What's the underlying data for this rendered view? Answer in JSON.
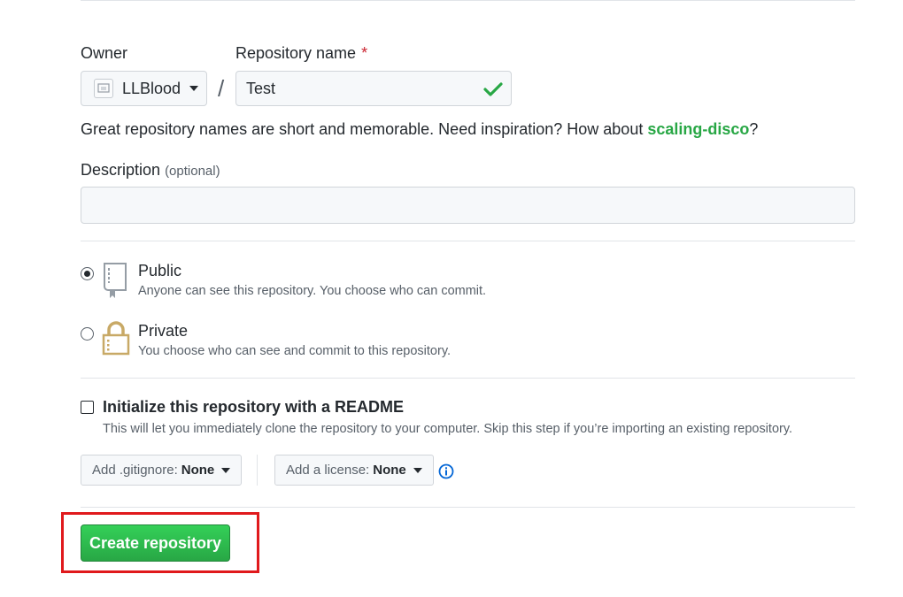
{
  "owner": {
    "label": "Owner",
    "value": "LLBlood"
  },
  "repo_name": {
    "label": "Repository name",
    "required_mark": "*",
    "value": "Test"
  },
  "separator": "/",
  "hint": {
    "prefix": "Great repository names are short and memorable. Need inspiration? How about ",
    "suggestion": "scaling-disco",
    "suffix": "?"
  },
  "description": {
    "label": "Description",
    "optional": "(optional)",
    "value": ""
  },
  "visibility": {
    "public": {
      "title": "Public",
      "desc": "Anyone can see this repository. You choose who can commit.",
      "selected": true
    },
    "private": {
      "title": "Private",
      "desc": "You choose who can see and commit to this repository.",
      "selected": false
    }
  },
  "init_readme": {
    "title": "Initialize this repository with a README",
    "desc": "This will let you immediately clone the repository to your computer. Skip this step if you’re importing an existing repository.",
    "checked": false
  },
  "gitignore": {
    "label": "Add .gitignore:",
    "value": "None"
  },
  "license": {
    "label": "Add a license:",
    "value": "None"
  },
  "create_button": "Create repository",
  "colors": {
    "accent_green": "#28a745",
    "highlight_red": "#e0191c",
    "lock_gold": "#c8a966"
  }
}
